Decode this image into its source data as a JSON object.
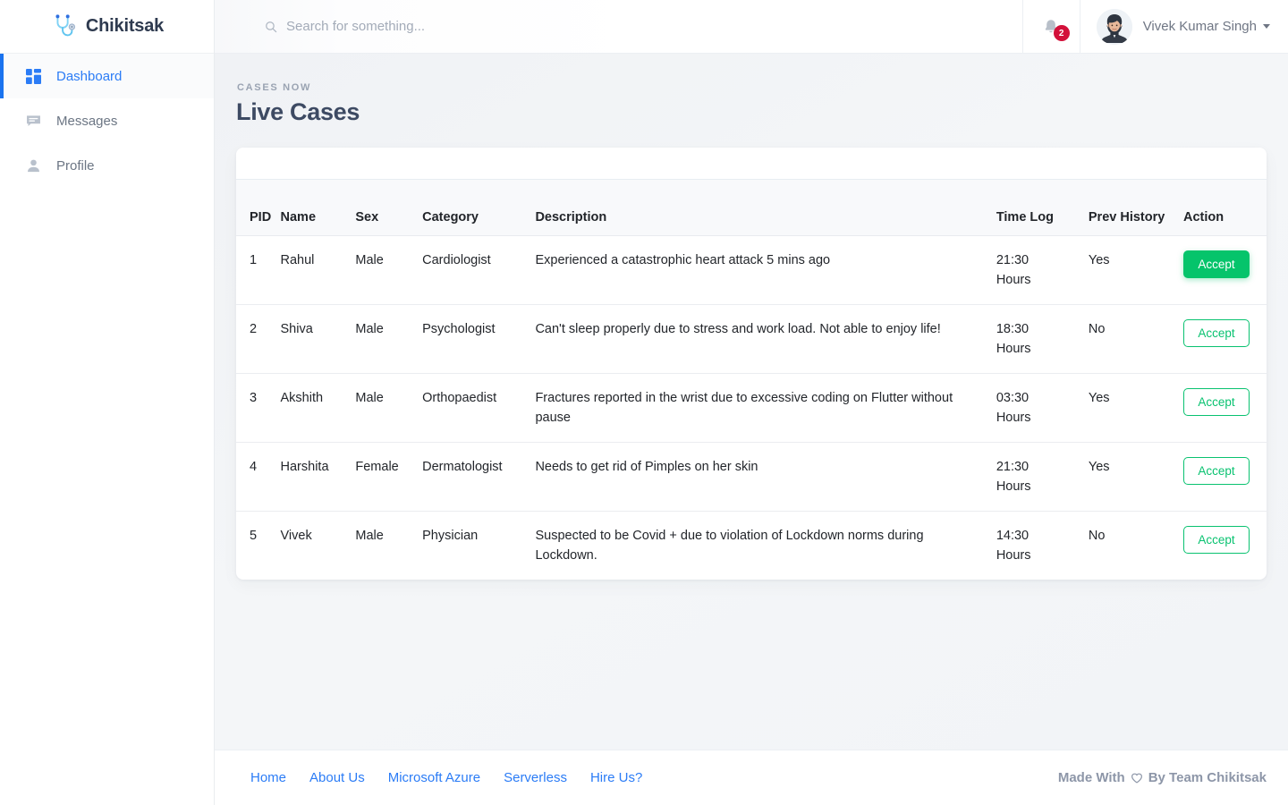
{
  "brand": {
    "name": "Chikitsak",
    "logo_icon": "stethoscope-icon"
  },
  "sidebar": {
    "items": [
      {
        "label": "Dashboard",
        "icon": "grid-icon",
        "active": true
      },
      {
        "label": "Messages",
        "icon": "chat-icon",
        "active": false
      },
      {
        "label": "Profile",
        "icon": "person-icon",
        "active": false
      }
    ]
  },
  "topbar": {
    "search": {
      "placeholder": "Search for something...",
      "value": "",
      "icon": "search-icon"
    },
    "notifications": {
      "icon": "bell-icon",
      "count": "2",
      "badge_color": "#d3103a"
    },
    "user": {
      "name": "Vivek Kumar Singh",
      "avatar_icon": "avatar",
      "caret_icon": "chevron-down-icon"
    }
  },
  "page": {
    "eyebrow": "CASES NOW",
    "title": "Live Cases"
  },
  "table": {
    "columns": [
      {
        "key": "pid",
        "label": "PID"
      },
      {
        "key": "name",
        "label": "Name"
      },
      {
        "key": "sex",
        "label": "Sex"
      },
      {
        "key": "cat",
        "label": "Category"
      },
      {
        "key": "desc",
        "label": "Description"
      },
      {
        "key": "time",
        "label": "Time Log"
      },
      {
        "key": "prev",
        "label": "Prev History"
      },
      {
        "key": "action",
        "label": "Action"
      }
    ],
    "rows": [
      {
        "pid": "1",
        "name": "Rahul",
        "sex": "Male",
        "cat": "Cardiologist",
        "desc": "Experienced a catastrophic heart attack 5 mins ago",
        "time_value": "21:30",
        "time_unit": "Hours",
        "prev": "Yes",
        "action_label": "Accept",
        "action_style": "primary"
      },
      {
        "pid": "2",
        "name": "Shiva",
        "sex": "Male",
        "cat": "Psychologist",
        "desc": "Can't sleep properly due to stress and work load. Not able to enjoy life!",
        "time_value": "18:30",
        "time_unit": "Hours",
        "prev": "No",
        "action_label": "Accept",
        "action_style": "outline"
      },
      {
        "pid": "3",
        "name": "Akshith",
        "sex": "Male",
        "cat": "Orthopaedist",
        "desc": "Fractures reported in the wrist due to excessive coding on Flutter without pause",
        "time_value": "03:30",
        "time_unit": "Hours",
        "prev": "Yes",
        "action_label": "Accept",
        "action_style": "outline"
      },
      {
        "pid": "4",
        "name": "Harshita",
        "sex": "Female",
        "cat": "Dermatologist",
        "desc": "Needs to get rid of Pimples on her skin",
        "time_value": "21:30",
        "time_unit": "Hours",
        "prev": "Yes",
        "action_label": "Accept",
        "action_style": "outline"
      },
      {
        "pid": "5",
        "name": "Vivek",
        "sex": "Male",
        "cat": "Physician",
        "desc": "Suspected to be Covid + due to violation of Lockdown norms during Lockdown.",
        "time_value": "14:30",
        "time_unit": "Hours",
        "prev": "No",
        "action_label": "Accept",
        "action_style": "outline"
      }
    ]
  },
  "footer": {
    "links": [
      {
        "label": "Home"
      },
      {
        "label": "About Us"
      },
      {
        "label": "Microsoft Azure"
      },
      {
        "label": "Serverless"
      },
      {
        "label": "Hire Us?"
      }
    ],
    "credit_prefix": "Made With",
    "credit_suffix": "By Team Chikitsak",
    "heart_icon": "heart-icon"
  },
  "colors": {
    "accent_blue": "#2b7cf6",
    "accept_green": "#05c46b",
    "badge_red": "#d3103a",
    "title_navy": "#3d4a63"
  }
}
